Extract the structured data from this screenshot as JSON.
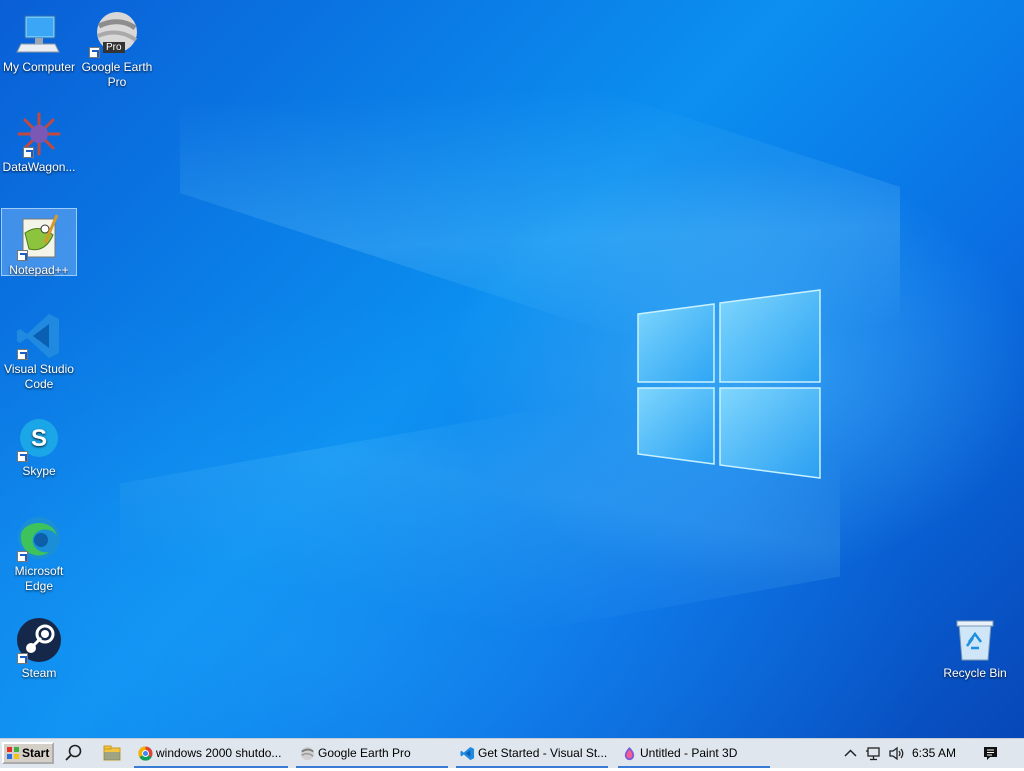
{
  "desktop": {
    "icons": [
      {
        "label": "My Computer",
        "icon": "computer-icon"
      },
      {
        "label": "Google Earth Pro",
        "icon": "google-earth-icon",
        "badge": "Pro"
      },
      {
        "label": "DataWagon...",
        "icon": "datawagon-icon"
      },
      {
        "label": "Notepad++",
        "icon": "notepad-plus-plus-icon"
      },
      {
        "label": "Visual Studio Code",
        "icon": "vscode-icon"
      },
      {
        "label": "Skype",
        "icon": "skype-icon",
        "glyph": "S"
      },
      {
        "label": "Microsoft Edge",
        "icon": "edge-icon"
      },
      {
        "label": "Steam",
        "icon": "steam-icon"
      },
      {
        "label": "Recycle Bin",
        "icon": "recycle-bin-icon"
      }
    ]
  },
  "taskbar": {
    "start_label": "Start",
    "tasks": [
      {
        "label": "windows 2000 shutdo...",
        "icon": "chrome-icon"
      },
      {
        "label": "Google Earth Pro",
        "icon": "google-earth-icon"
      },
      {
        "label": "Get Started - Visual St...",
        "icon": "vscode-icon"
      },
      {
        "label": "Untitled - Paint 3D",
        "icon": "paint3d-icon"
      }
    ],
    "clock": "6:35 AM",
    "colors": {
      "accent": "#3a7bd5",
      "taskbar_bg": "#dfe6ee"
    }
  }
}
